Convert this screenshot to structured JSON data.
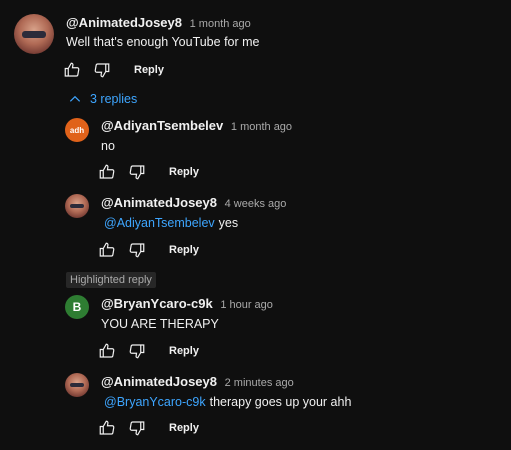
{
  "main_comment": {
    "author": "@AnimatedJosey8",
    "time": "1 month ago",
    "text": "Well that's enough YouTube for me",
    "reply_label": "Reply"
  },
  "replies_toggle": {
    "label": "3 replies"
  },
  "replies": [
    {
      "author": "@AdiyanTsembelev",
      "time": "1 month ago",
      "avatar_text": "adh",
      "mention": "",
      "text": "no",
      "reply_label": "Reply"
    },
    {
      "author": "@AnimatedJosey8",
      "time": "4 weeks ago",
      "mention": "@AdiyanTsembelev",
      "text": "yes",
      "reply_label": "Reply"
    }
  ],
  "highlighted": {
    "badge": "Highlighted reply",
    "author": "@BryanYcaro-c9k",
    "time": "1 hour ago",
    "avatar_text": "B",
    "text": "YOU ARE THERAPY",
    "reply_label": "Reply"
  },
  "last_reply": {
    "author": "@AnimatedJosey8",
    "time": "2 minutes ago",
    "mention": "@BryanYcaro-c9k",
    "text": "therapy goes up your ahh",
    "reply_label": "Reply"
  },
  "colors": {
    "background": "#0f0f0f",
    "link": "#3ea6ff",
    "muted": "#aaaaaa"
  },
  "icons": [
    "like-icon",
    "dislike-icon",
    "chevron-up-icon"
  ]
}
